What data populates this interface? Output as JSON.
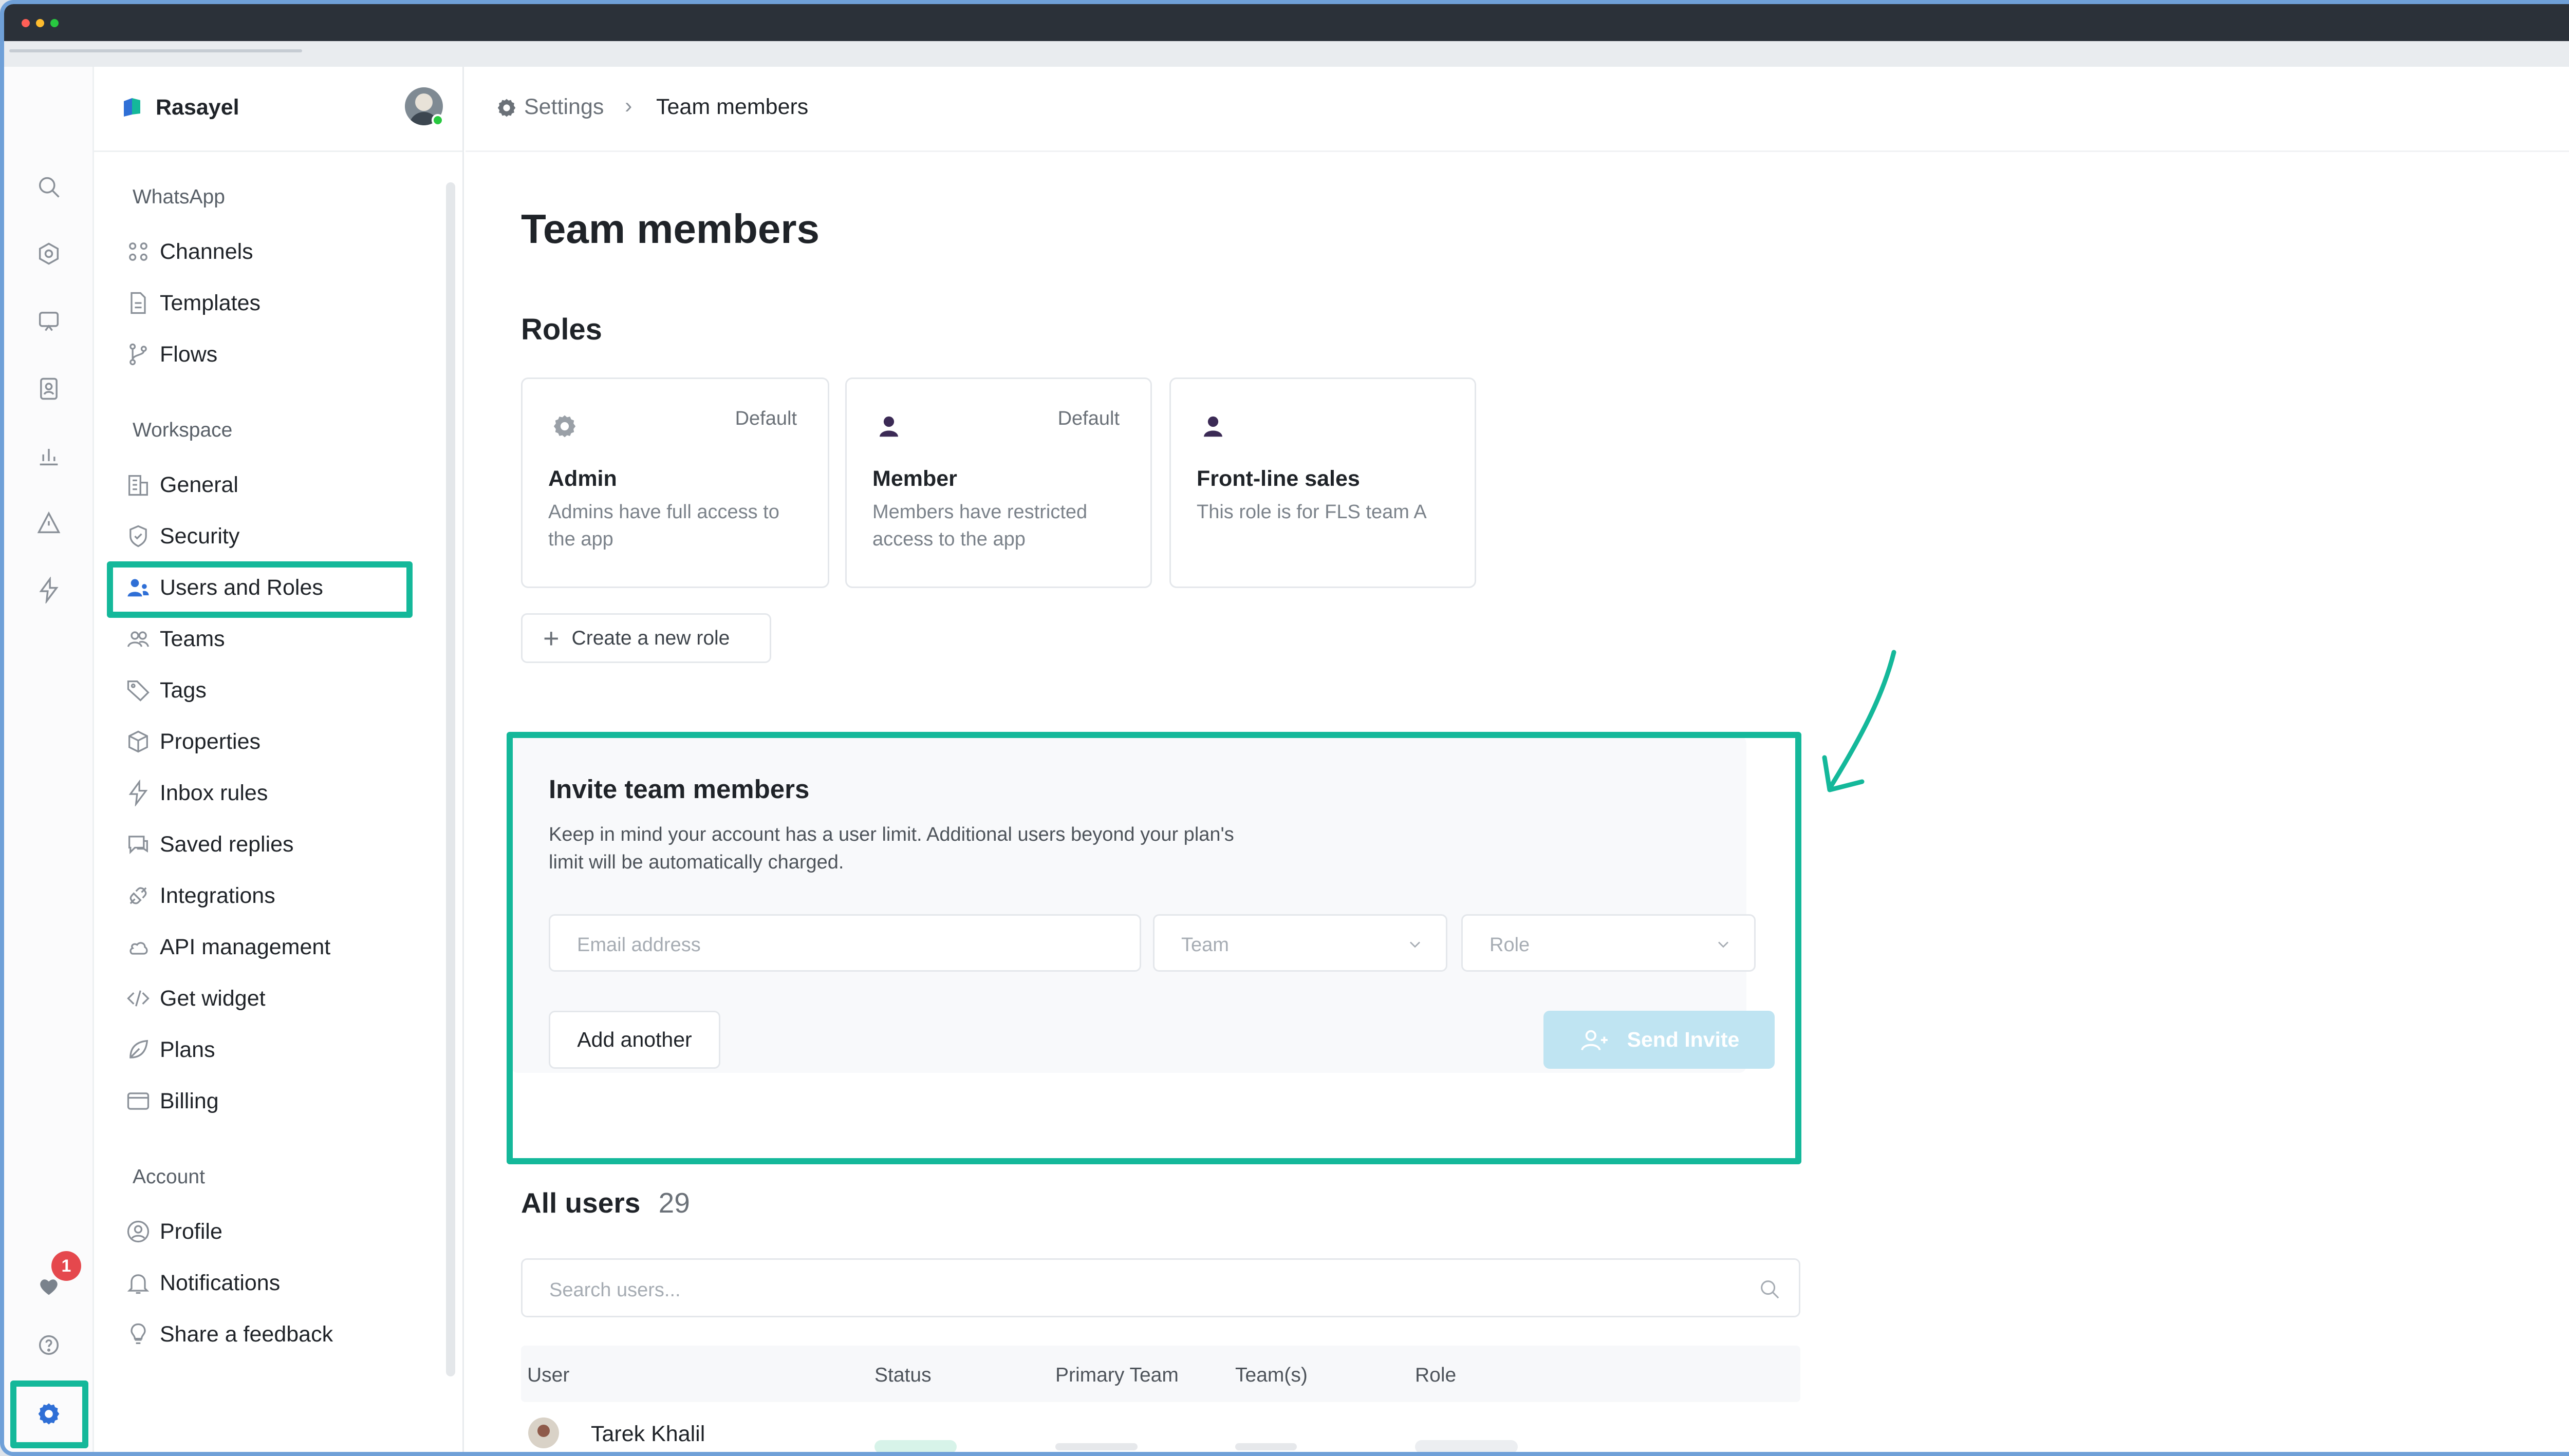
{
  "colors": {
    "accent": "#14b89a",
    "titlebar": "#2b3139",
    "sidebar_active": "#2f6fd6",
    "badge": "#e5484d"
  },
  "sidebar": {
    "workspace_name": "Rasayel",
    "groups": [
      {
        "label": "WhatsApp",
        "items": [
          {
            "label": "Channels",
            "icon": "channels-icon"
          },
          {
            "label": "Templates",
            "icon": "document-icon"
          },
          {
            "label": "Flows",
            "icon": "branch-icon"
          }
        ]
      },
      {
        "label": "Workspace",
        "items": [
          {
            "label": "General",
            "icon": "building-icon"
          },
          {
            "label": "Security",
            "icon": "shield-icon"
          },
          {
            "label": "Users and Roles",
            "icon": "users-icon",
            "active": true
          },
          {
            "label": "Teams",
            "icon": "team-icon"
          },
          {
            "label": "Tags",
            "icon": "tag-icon"
          },
          {
            "label": "Properties",
            "icon": "cube-icon"
          },
          {
            "label": "Inbox rules",
            "icon": "bolt-icon"
          },
          {
            "label": "Saved replies",
            "icon": "chat-icon"
          },
          {
            "label": "Integrations",
            "icon": "plug-icon"
          },
          {
            "label": "API management",
            "icon": "cloud-icon"
          },
          {
            "label": "Get widget",
            "icon": "code-icon"
          },
          {
            "label": "Plans",
            "icon": "leaf-icon"
          },
          {
            "label": "Billing",
            "icon": "card-icon"
          }
        ]
      },
      {
        "label": "Account",
        "items": [
          {
            "label": "Profile",
            "icon": "profile-icon"
          },
          {
            "label": "Notifications",
            "icon": "bell-icon"
          },
          {
            "label": "Share a feedback",
            "icon": "bulb-icon"
          }
        ]
      }
    ]
  },
  "rail": {
    "badge_count": "1"
  },
  "breadcrumb": {
    "root": "Settings",
    "current": "Team members"
  },
  "page": {
    "title": "Team members"
  },
  "roles": {
    "heading": "Roles",
    "cards": [
      {
        "title": "Admin",
        "desc": "Admins have full access to the app",
        "default": "Default",
        "icon": "gear-icon"
      },
      {
        "title": "Member",
        "desc": "Members have restricted access to the app",
        "default": "Default",
        "icon": "person-icon"
      },
      {
        "title": "Front-line sales",
        "desc": "This role is for FLS team A",
        "default": "",
        "icon": "person-icon"
      }
    ],
    "create_label": "Create a new role"
  },
  "invite": {
    "title": "Invite team members",
    "desc": "Keep in mind your account has a user limit. Additional users beyond your plan's limit will be automatically charged.",
    "email_placeholder": "Email address",
    "team_placeholder": "Team",
    "role_placeholder": "Role",
    "add_another": "Add another",
    "send_invite": "Send Invite"
  },
  "users": {
    "heading": "All users",
    "count": "29",
    "search_placeholder": "Search users...",
    "columns": [
      "User",
      "Status",
      "Primary Team",
      "Team(s)",
      "Role"
    ],
    "first_row_name": "Tarek Khalil"
  }
}
